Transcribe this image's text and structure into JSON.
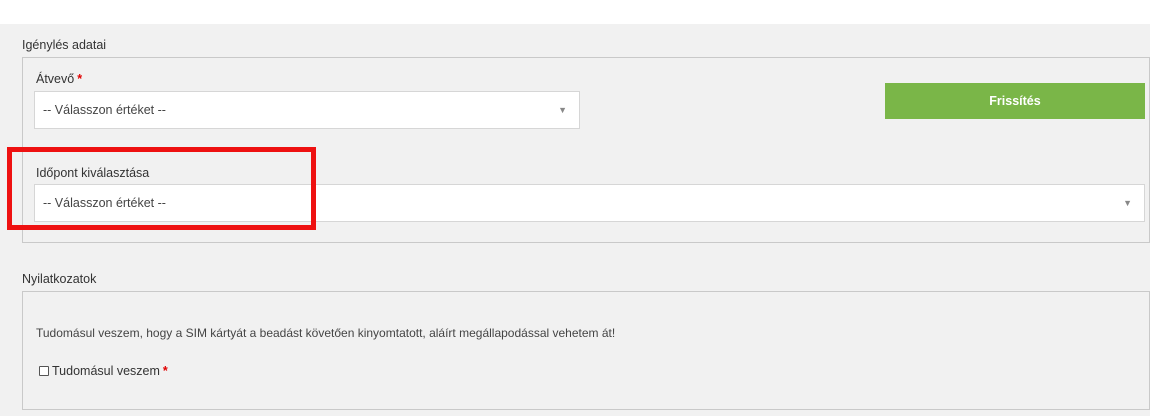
{
  "request_section": {
    "title": "Igénylés adatai",
    "recipient": {
      "label": "Átvevő",
      "required_mark": "*",
      "value": "-- Válasszon értéket --"
    },
    "refresh_button": "Frissítés",
    "time_slot": {
      "label": "Időpont kiválasztása",
      "value": "-- Válasszon értéket --"
    }
  },
  "declarations_section": {
    "title": "Nyilatkozatok",
    "notice": "Tudomásul veszem, hogy a SIM kártyát a beadást követően kinyomtatott, aláírt megállapodással vehetem át!",
    "checkbox_label": "Tudomásul veszem",
    "required_mark": "*",
    "checked": false
  },
  "icons": {
    "dropdown": "chevron-down-icon",
    "dropdown_glyph": "▼"
  },
  "colors": {
    "button": "#7ab648",
    "highlight": "#ee1111",
    "required": "#e00000"
  }
}
